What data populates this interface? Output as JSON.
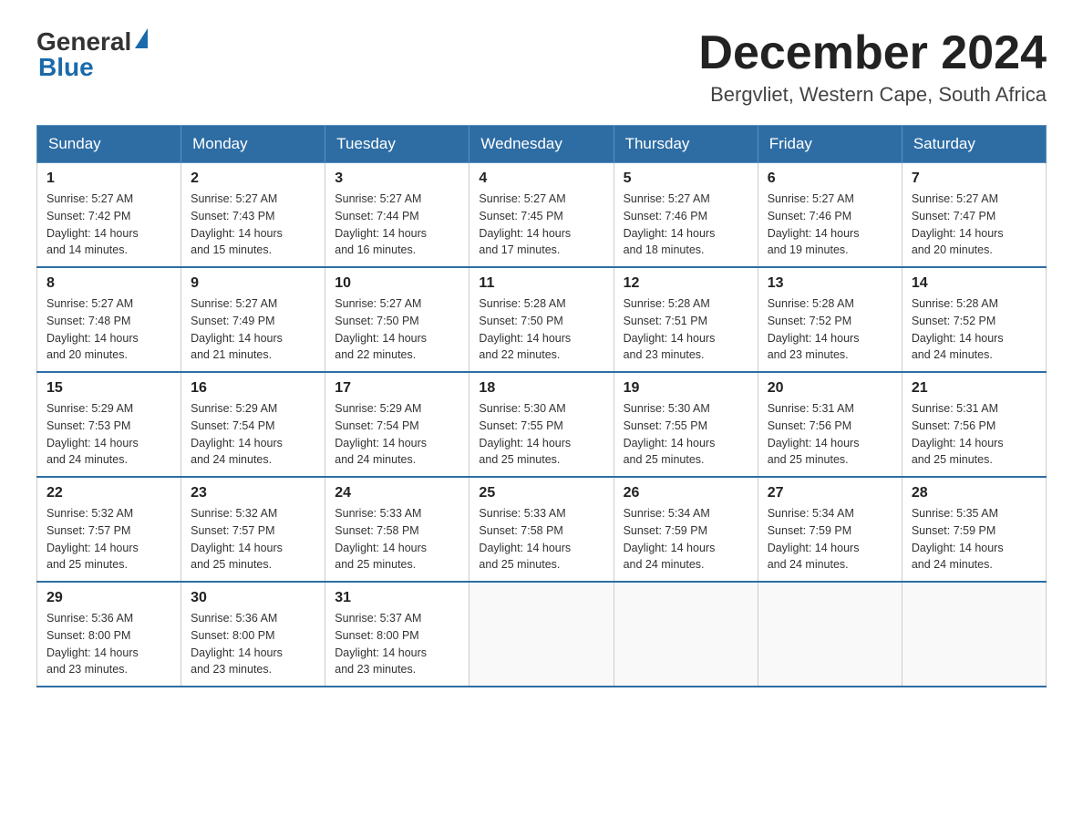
{
  "header": {
    "logo_general": "General",
    "logo_blue": "Blue",
    "month_title": "December 2024",
    "location": "Bergvliet, Western Cape, South Africa"
  },
  "weekdays": [
    "Sunday",
    "Monday",
    "Tuesday",
    "Wednesday",
    "Thursday",
    "Friday",
    "Saturday"
  ],
  "weeks": [
    [
      {
        "day": "1",
        "sunrise": "5:27 AM",
        "sunset": "7:42 PM",
        "daylight": "14 hours and 14 minutes."
      },
      {
        "day": "2",
        "sunrise": "5:27 AM",
        "sunset": "7:43 PM",
        "daylight": "14 hours and 15 minutes."
      },
      {
        "day": "3",
        "sunrise": "5:27 AM",
        "sunset": "7:44 PM",
        "daylight": "14 hours and 16 minutes."
      },
      {
        "day": "4",
        "sunrise": "5:27 AM",
        "sunset": "7:45 PM",
        "daylight": "14 hours and 17 minutes."
      },
      {
        "day": "5",
        "sunrise": "5:27 AM",
        "sunset": "7:46 PM",
        "daylight": "14 hours and 18 minutes."
      },
      {
        "day": "6",
        "sunrise": "5:27 AM",
        "sunset": "7:46 PM",
        "daylight": "14 hours and 19 minutes."
      },
      {
        "day": "7",
        "sunrise": "5:27 AM",
        "sunset": "7:47 PM",
        "daylight": "14 hours and 20 minutes."
      }
    ],
    [
      {
        "day": "8",
        "sunrise": "5:27 AM",
        "sunset": "7:48 PM",
        "daylight": "14 hours and 20 minutes."
      },
      {
        "day": "9",
        "sunrise": "5:27 AM",
        "sunset": "7:49 PM",
        "daylight": "14 hours and 21 minutes."
      },
      {
        "day": "10",
        "sunrise": "5:27 AM",
        "sunset": "7:50 PM",
        "daylight": "14 hours and 22 minutes."
      },
      {
        "day": "11",
        "sunrise": "5:28 AM",
        "sunset": "7:50 PM",
        "daylight": "14 hours and 22 minutes."
      },
      {
        "day": "12",
        "sunrise": "5:28 AM",
        "sunset": "7:51 PM",
        "daylight": "14 hours and 23 minutes."
      },
      {
        "day": "13",
        "sunrise": "5:28 AM",
        "sunset": "7:52 PM",
        "daylight": "14 hours and 23 minutes."
      },
      {
        "day": "14",
        "sunrise": "5:28 AM",
        "sunset": "7:52 PM",
        "daylight": "14 hours and 24 minutes."
      }
    ],
    [
      {
        "day": "15",
        "sunrise": "5:29 AM",
        "sunset": "7:53 PM",
        "daylight": "14 hours and 24 minutes."
      },
      {
        "day": "16",
        "sunrise": "5:29 AM",
        "sunset": "7:54 PM",
        "daylight": "14 hours and 24 minutes."
      },
      {
        "day": "17",
        "sunrise": "5:29 AM",
        "sunset": "7:54 PM",
        "daylight": "14 hours and 24 minutes."
      },
      {
        "day": "18",
        "sunrise": "5:30 AM",
        "sunset": "7:55 PM",
        "daylight": "14 hours and 25 minutes."
      },
      {
        "day": "19",
        "sunrise": "5:30 AM",
        "sunset": "7:55 PM",
        "daylight": "14 hours and 25 minutes."
      },
      {
        "day": "20",
        "sunrise": "5:31 AM",
        "sunset": "7:56 PM",
        "daylight": "14 hours and 25 minutes."
      },
      {
        "day": "21",
        "sunrise": "5:31 AM",
        "sunset": "7:56 PM",
        "daylight": "14 hours and 25 minutes."
      }
    ],
    [
      {
        "day": "22",
        "sunrise": "5:32 AM",
        "sunset": "7:57 PM",
        "daylight": "14 hours and 25 minutes."
      },
      {
        "day": "23",
        "sunrise": "5:32 AM",
        "sunset": "7:57 PM",
        "daylight": "14 hours and 25 minutes."
      },
      {
        "day": "24",
        "sunrise": "5:33 AM",
        "sunset": "7:58 PM",
        "daylight": "14 hours and 25 minutes."
      },
      {
        "day": "25",
        "sunrise": "5:33 AM",
        "sunset": "7:58 PM",
        "daylight": "14 hours and 25 minutes."
      },
      {
        "day": "26",
        "sunrise": "5:34 AM",
        "sunset": "7:59 PM",
        "daylight": "14 hours and 24 minutes."
      },
      {
        "day": "27",
        "sunrise": "5:34 AM",
        "sunset": "7:59 PM",
        "daylight": "14 hours and 24 minutes."
      },
      {
        "day": "28",
        "sunrise": "5:35 AM",
        "sunset": "7:59 PM",
        "daylight": "14 hours and 24 minutes."
      }
    ],
    [
      {
        "day": "29",
        "sunrise": "5:36 AM",
        "sunset": "8:00 PM",
        "daylight": "14 hours and 23 minutes."
      },
      {
        "day": "30",
        "sunrise": "5:36 AM",
        "sunset": "8:00 PM",
        "daylight": "14 hours and 23 minutes."
      },
      {
        "day": "31",
        "sunrise": "5:37 AM",
        "sunset": "8:00 PM",
        "daylight": "14 hours and 23 minutes."
      },
      null,
      null,
      null,
      null
    ]
  ],
  "labels": {
    "sunrise": "Sunrise:",
    "sunset": "Sunset:",
    "daylight": "Daylight:"
  }
}
